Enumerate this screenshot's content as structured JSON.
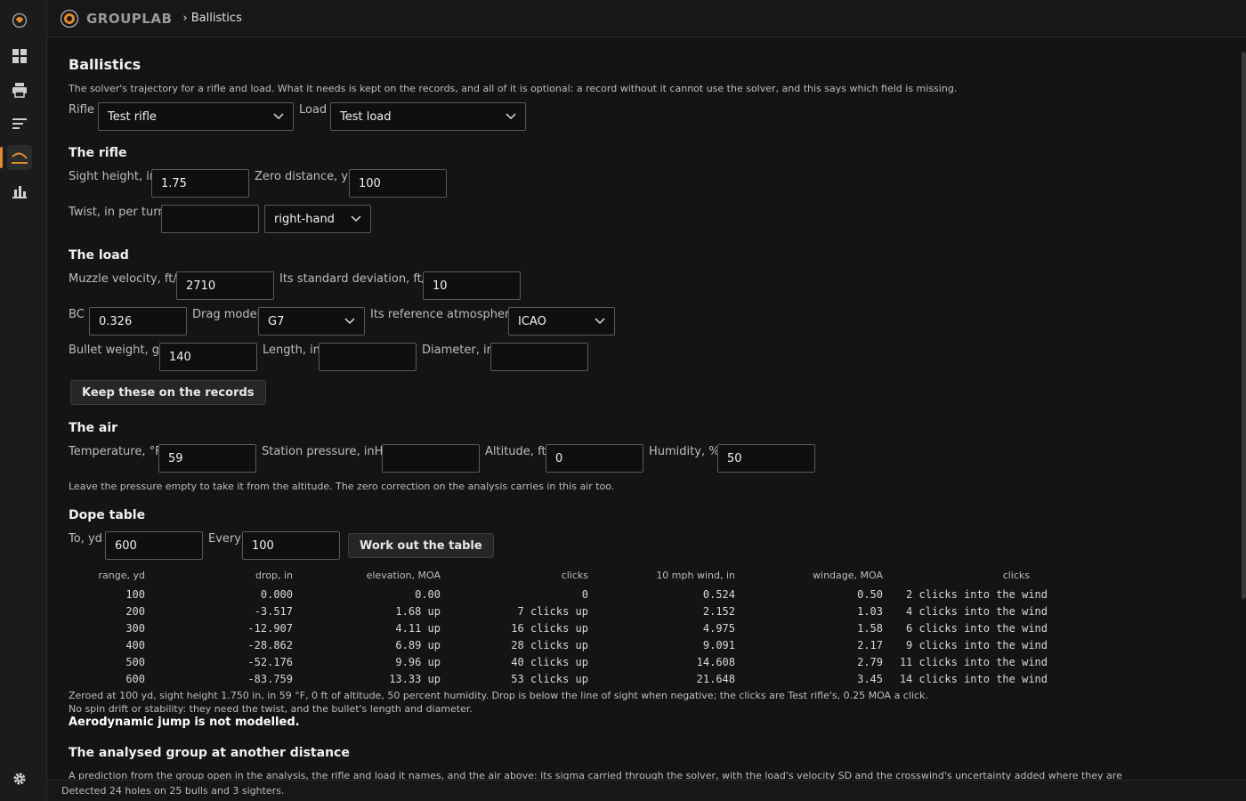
{
  "app": {
    "brand": "GROUPLAB",
    "breadcrumb": "› Ballistics"
  },
  "page": {
    "title": "Ballistics",
    "description": "The solver's trajectory for a rifle and load. What it needs is kept on the records, and all of it is optional: a record without it cannot use the solver, and this says which field is missing.",
    "rifle_label": "Rifle",
    "rifle_value": "Test rifle",
    "load_label": "Load",
    "load_value": "Test load"
  },
  "rifle": {
    "heading": "The rifle",
    "sight_height_label": "Sight height, in",
    "sight_height": "1.75",
    "zero_distance_label": "Zero distance, yd",
    "zero_distance": "100",
    "twist_label": "Twist, in per turn",
    "twist": "",
    "twist_dir": "right-hand"
  },
  "load": {
    "heading": "The load",
    "mv_label": "Muzzle velocity, ft/s",
    "mv": "2710",
    "sd_label": "Its standard deviation, ft/s",
    "sd": "10",
    "bc_label": "BC",
    "bc": "0.326",
    "drag_label": "Drag model",
    "drag": "G7",
    "atmos_label": "Its reference atmosphere",
    "atmos": "ICAO",
    "weight_label": "Bullet weight, gr",
    "weight": "140",
    "length_label": "Length, in",
    "length": "",
    "diameter_label": "Diameter, in",
    "diameter": "",
    "keep_button": "Keep these on the records"
  },
  "air": {
    "heading": "The air",
    "temp_label": "Temperature, °F",
    "temp": "59",
    "pressure_label": "Station pressure, inHg",
    "pressure": "",
    "altitude_label": "Altitude, ft",
    "altitude": "0",
    "humidity_label": "Humidity, %",
    "humidity": "50",
    "note": "Leave the pressure empty to take it from the altitude. The zero correction on the analysis carries in this air too."
  },
  "dope": {
    "heading": "Dope table",
    "to_label": "To, yd",
    "to": "600",
    "every_label": "Every",
    "every": "100",
    "work_button": "Work out the table",
    "columns": [
      "range, yd",
      "drop, in",
      "elevation, MOA",
      "clicks",
      "10 mph wind, in",
      "windage, MOA",
      "clicks"
    ],
    "rows": [
      [
        "100",
        "0.000",
        "0.00",
        "0",
        "0.524",
        "0.50",
        "2 clicks into the wind"
      ],
      [
        "200",
        "-3.517",
        "1.68 up",
        "7 clicks up",
        "2.152",
        "1.03",
        "4 clicks into the wind"
      ],
      [
        "300",
        "-12.907",
        "4.11 up",
        "16 clicks up",
        "4.975",
        "1.58",
        "6 clicks into the wind"
      ],
      [
        "400",
        "-28.862",
        "6.89 up",
        "28 clicks up",
        "9.091",
        "2.17",
        "9 clicks into the wind"
      ],
      [
        "500",
        "-52.176",
        "9.96 up",
        "40 clicks up",
        "14.608",
        "2.79",
        "11 clicks into the wind"
      ],
      [
        "600",
        "-83.759",
        "13.33 up",
        "53 clicks up",
        "21.648",
        "3.45",
        "14 clicks into the wind"
      ]
    ],
    "note1": "Zeroed at 100 yd, sight height 1.750 in, in 59 °F, 0 ft of altitude, 50 percent humidity. Drop is below the line of sight when negative; the clicks are Test rifle's, 0.25 MOA a click.",
    "note2": "No spin drift or stability: they need the twist, and the bullet's length and diameter.",
    "note3": "Aerodynamic jump is not modelled."
  },
  "group": {
    "heading": "The analysed group at another distance",
    "desc": "A prediction from the group open in the analysis, the rifle and load it names, and the air above: its sigma carried through the solver, with the load's velocity SD and the crosswind's uncertainty added where they are"
  },
  "status": {
    "text": "Detected 24 holes on 25 bulls and 3 sighters."
  },
  "colors": {
    "accent": "#e08a2a",
    "background": "#141414"
  }
}
